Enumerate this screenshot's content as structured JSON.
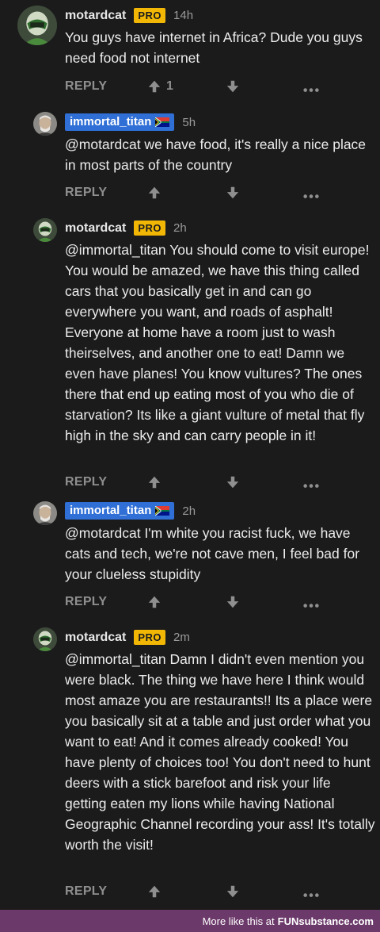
{
  "comments": [
    {
      "username": "motardcat",
      "badge": "PRO",
      "time": "14h",
      "text": "You guys have internet in Africa? Dude you guys need food not internet",
      "reply_label": "REPLY",
      "upvotes": "1"
    },
    {
      "username": "immortal_titan",
      "time": "5h",
      "text": "@motardcat we have food, it's really a nice place in most parts of the country",
      "reply_label": "REPLY"
    },
    {
      "username": "motardcat",
      "badge": "PRO",
      "time": "2h",
      "text": "@immortal_titan You should come to visit europe! You would be amazed, we have this thing called cars that you basically get in and can go everywhere you want, and roads of asphalt! Everyone at home have a room just to wash theirselves, and another one to eat! Damn we even have planes! You know vultures? The ones there that end up eating most of you who die of starvation? Its like a giant vulture of metal that fly high in the sky and can carry people in it!",
      "reply_label": "REPLY"
    },
    {
      "username": "immortal_titan",
      "time": "2h",
      "text": "@motardcat I'm white you racist fuck, we have cats and tech, we're not cave men, I feel bad for your clueless stupidity",
      "reply_label": "REPLY"
    },
    {
      "username": "motardcat",
      "badge": "PRO",
      "time": "2m",
      "text": "@immortal_titan Damn I didn't even mention you were black. The thing we have here I think would most amaze you are restaurants!! Its a place were you basically sit at a table and just order what you want to eat! And it comes already cooked! You have plenty of choices too! You don't need to hunt deers with a stick barefoot and risk your life getting eaten my lions while having National Geographic Channel recording your ass! It's totally worth the visit!",
      "reply_label": "REPLY"
    }
  ],
  "footer": {
    "text": "More like this at",
    "brand": "FUNsubstance.com"
  },
  "colors": {
    "background": "#1b1b1c",
    "pro_badge": "#f2b705",
    "username_highlight": "#2f6fd6",
    "footer": "#6c3a6a"
  },
  "icons": [
    "upvote-arrow-icon",
    "downvote-arrow-icon",
    "more-options-icon",
    "south-africa-flag-icon"
  ]
}
